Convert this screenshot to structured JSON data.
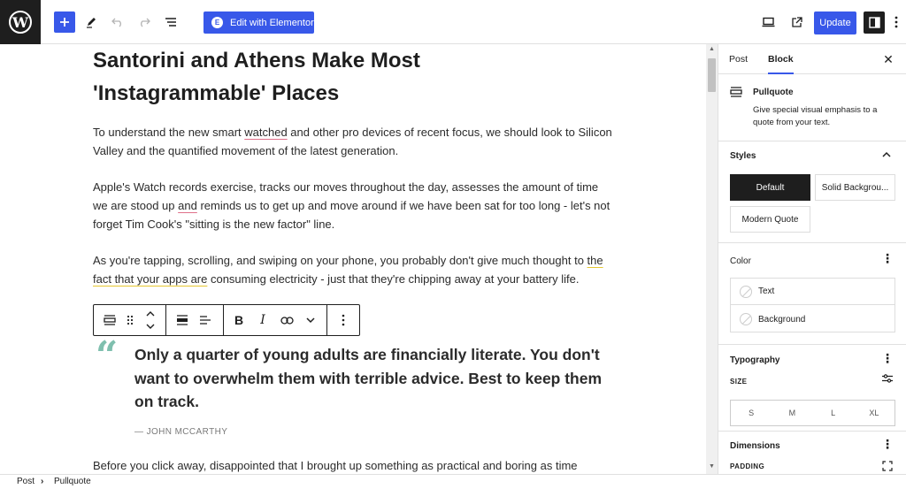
{
  "colors": {
    "accent": "#3858e9",
    "dark": "#1e1e1e",
    "quote_mark": "#7fbfae"
  },
  "topbar": {
    "logo": "W",
    "add_icon": "plus-icon",
    "tools_icon": "pen-icon",
    "undo_icon": "undo-icon",
    "redo_icon": "redo-icon",
    "outline_icon": "list-view-icon",
    "elementor_label": "Edit with Elementor",
    "elementor_icon_glyph": "E",
    "preview_icon": "desktop-icon",
    "view_post_icon": "external-link-icon",
    "update_label": "Update",
    "settings_icon": "sidebar-toggle-icon",
    "options_icon": "more-vertical-icon"
  },
  "editor": {
    "title": "Santorini and Athens Make Most 'Instagrammable' Places",
    "p1": {
      "a": "To understand the new smart ",
      "u": "watched",
      "b": " and other pro devices of recent focus, we should look to Silicon Valley and the quantified movement of the latest generation."
    },
    "p2": {
      "a": "Apple's Watch records exercise, tracks our moves throughout the day, assesses the amount of time we are stood up ",
      "u": "and",
      "b": " reminds us to get up and move around if we have been sat for too long - let's not forget Tim Cook's \"sitting is the new factor\" line."
    },
    "p3": {
      "a": "As you're tapping, scrolling, and swiping on your phone, you probably don't give much thought to ",
      "u": "the fact that your apps are",
      "b": " consuming electricity - just that they're chipping away at your battery life."
    },
    "block_toolbar": {
      "bold": "B",
      "italic": "I"
    },
    "pullquote": {
      "mark": "“",
      "text": "Only a quarter of young adults are financially literate. You don't want to overwhelm them with terrible advice. Best to keep them on track.",
      "citation": "— JOHN MCCARTHY"
    },
    "p4": "Before you click away, disappointed that I brought up something as practical and boring as time"
  },
  "sidebar": {
    "tab_post": "Post",
    "tab_block": "Block",
    "close": "✕",
    "block_name": "Pullquote",
    "block_desc": "Give special visual emphasis to a quote from your text.",
    "styles_heading": "Styles",
    "style_default": "Default",
    "style_solid": "Solid Backgrou...",
    "style_modern": "Modern Quote",
    "color_heading": "Color",
    "color_text": "Text",
    "color_background": "Background",
    "typography_heading": "Typography",
    "size_label": "SIZE",
    "sizes": [
      "S",
      "M",
      "L",
      "XL"
    ],
    "dimensions_heading": "Dimensions",
    "padding_label": "PADDING"
  },
  "footer": {
    "crumb_1": "Post",
    "separator": "›",
    "crumb_2": "Pullquote"
  }
}
